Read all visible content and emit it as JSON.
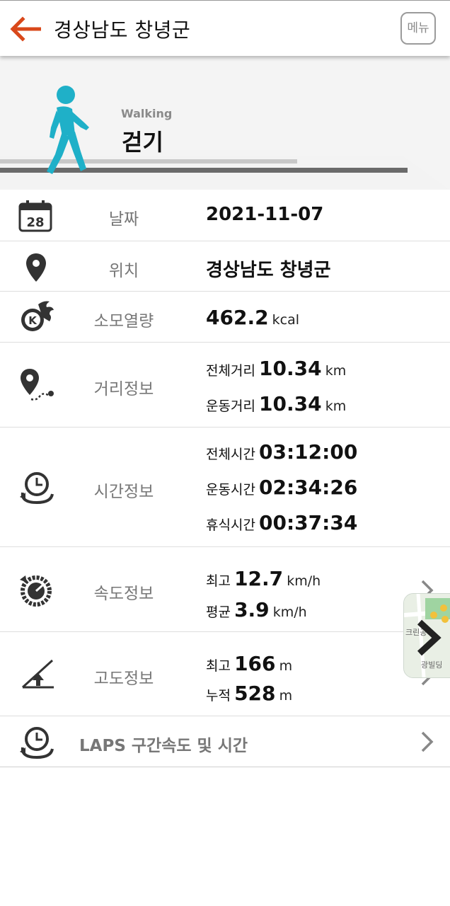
{
  "header": {
    "title": "경상남도 창녕군",
    "menu_label": "메뉴"
  },
  "hero": {
    "subtitle": "Walking",
    "title": "걷기"
  },
  "date": {
    "label": "날짜",
    "value": "2021-11-07",
    "calendar_day": "28"
  },
  "location": {
    "label": "위치",
    "value": "경상남도 창녕군"
  },
  "calories": {
    "label": "소모열량",
    "value": "462.2",
    "unit": "kcal",
    "badge": "K"
  },
  "distance": {
    "label": "거리정보",
    "total_label": "전체거리",
    "total_value": "10.34",
    "total_unit": "km",
    "moving_label": "운동거리",
    "moving_value": "10.34",
    "moving_unit": "km"
  },
  "time": {
    "label": "시간정보",
    "total_label": "전체시간",
    "total_value": "03:12:00",
    "moving_label": "운동시간",
    "moving_value": "02:34:26",
    "rest_label": "휴식시간",
    "rest_value": "00:37:34"
  },
  "speed": {
    "label": "속도정보",
    "max_label": "최고",
    "max_value": "12.7",
    "max_unit": "km/h",
    "avg_label": "평균",
    "avg_value": "3.9",
    "avg_unit": "km/h"
  },
  "altitude": {
    "label": "고도정보",
    "max_label": "최고",
    "max_value": "166",
    "max_unit": "m",
    "cumulative_label": "누적",
    "cumulative_value": "528",
    "cumulative_unit": "m"
  },
  "laps": {
    "label": "LAPS 구간속도 및 시간"
  },
  "map_thumb": {
    "text1": "크린공",
    "text2": "광빌딩"
  },
  "icons": {
    "back": "back-arrow-icon",
    "menu": "menu-button",
    "walker": "walking-person-icon",
    "calendar": "calendar-icon",
    "pin": "location-pin-icon",
    "calorie": "calorie-flame-icon",
    "distance": "route-pin-icon",
    "time": "clock-icon",
    "speed": "speedometer-icon",
    "altitude": "altitude-slope-icon",
    "laps": "laps-clock-icon",
    "chevron": "chevron-right-icon"
  },
  "colors": {
    "accent_orange": "#d9481a",
    "walker_cyan": "#1fb0c8",
    "icon_dark": "#333333",
    "label_gray": "#777777"
  }
}
